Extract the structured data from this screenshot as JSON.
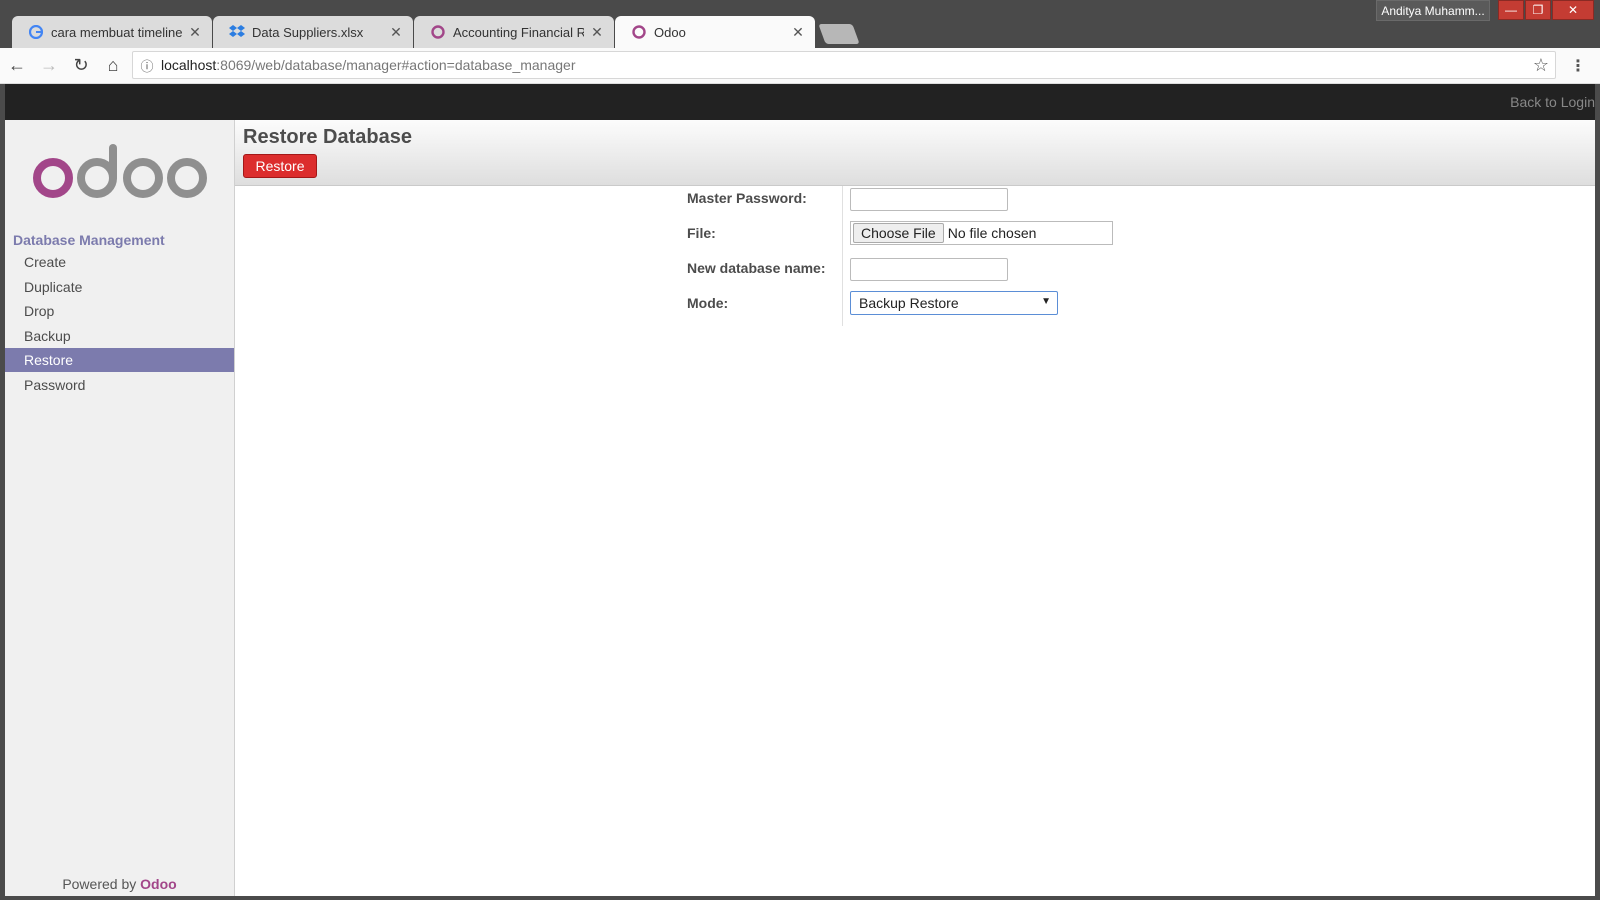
{
  "browser": {
    "tabs": [
      {
        "title": "cara membuat timeline k",
        "icon": "google-icon"
      },
      {
        "title": "Data Suppliers.xlsx",
        "icon": "dropbox-icon"
      },
      {
        "title": "Accounting Financial Rep",
        "icon": "odoo-icon"
      },
      {
        "title": "Odoo",
        "icon": "odoo-icon"
      }
    ],
    "profile_name": "Anditya Muhamm...",
    "url_host": "localhost",
    "url_rest": ":8069/web/database/manager#action=database_manager"
  },
  "topbar": {
    "back_to_login": "Back to Login"
  },
  "sidebar": {
    "logo_text": "odoo",
    "heading": "Database Management",
    "items": [
      {
        "label": "Create"
      },
      {
        "label": "Duplicate"
      },
      {
        "label": "Drop"
      },
      {
        "label": "Backup"
      },
      {
        "label": "Restore",
        "active": true
      },
      {
        "label": "Password"
      }
    ],
    "powered_prefix": "Powered by",
    "powered_brand": "Odoo"
  },
  "main": {
    "title": "Restore Database",
    "restore_button": "Restore",
    "form": {
      "master_password_label": "Master Password:",
      "file_label": "File:",
      "choose_file": "Choose File",
      "no_file": "No file chosen",
      "new_db_label": "New database name:",
      "mode_label": "Mode:",
      "mode_value": "Backup Restore"
    }
  },
  "colors": {
    "accent": "#7c7bad",
    "button": "#dc2d2d",
    "brand": "#a24689"
  }
}
